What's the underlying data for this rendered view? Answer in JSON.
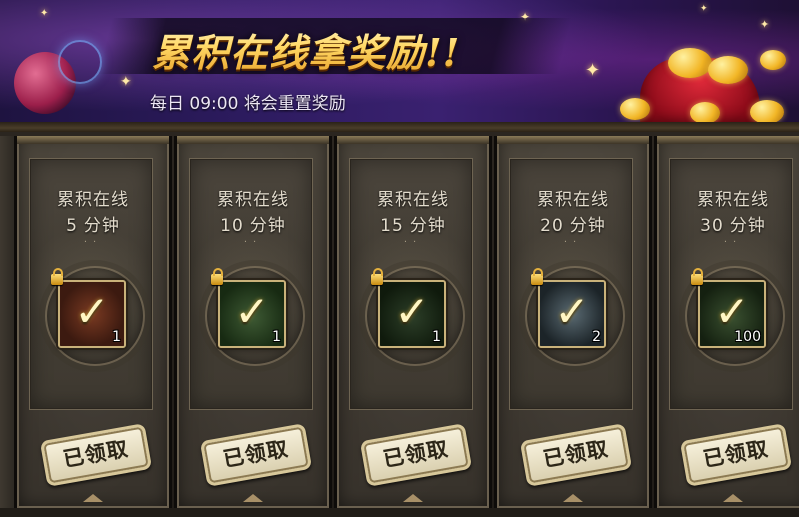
{
  "banner": {
    "title": "累积在线拿奖励!!",
    "subtitle": "每日 09:00 将会重置奖励"
  },
  "cards": [
    {
      "label": "累积在线",
      "minutes": "5",
      "unit": "分钟",
      "quantity": "1",
      "status": "已领取",
      "item_icon": "scroll-item-icon"
    },
    {
      "label": "累积在线",
      "minutes": "10",
      "unit": "分钟",
      "quantity": "1",
      "status": "已领取",
      "item_icon": "silver-plate-icon"
    },
    {
      "label": "累积在线",
      "minutes": "15",
      "unit": "分钟",
      "quantity": "1",
      "status": "已领取",
      "item_icon": "iron-plate-icon"
    },
    {
      "label": "累积在线",
      "minutes": "20",
      "unit": "分钟",
      "quantity": "2",
      "status": "已领取",
      "item_icon": "card-item-icon"
    },
    {
      "label": "累积在线",
      "minutes": "30",
      "unit": "分钟",
      "quantity": "100",
      "status": "已领取",
      "item_icon": "silver-ingot-icon"
    }
  ],
  "colors": {
    "title_gold": "#ffd865",
    "card_bg": "#413b33",
    "frame_gold": "#c9b27a",
    "stamp_bg": "#efe7cc"
  }
}
